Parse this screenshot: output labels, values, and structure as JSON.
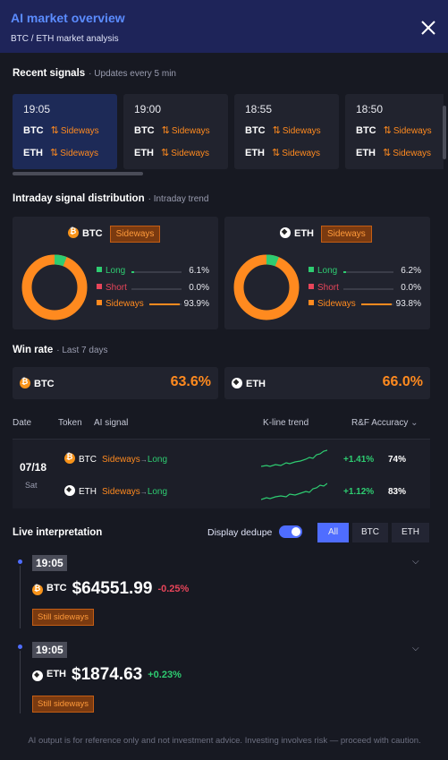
{
  "header": {
    "title": "AI market overview",
    "subtitle": "BTC / ETH market analysis",
    "close_icon": "close-icon"
  },
  "recent_signals": {
    "title": "Recent signals",
    "subtitle": "· Updates every 5 min",
    "cards": [
      {
        "time": "19:05",
        "rows": [
          {
            "token": "BTC",
            "state": "Sideways"
          },
          {
            "token": "ETH",
            "state": "Sideways"
          }
        ]
      },
      {
        "time": "19:00",
        "rows": [
          {
            "token": "BTC",
            "state": "Sideways"
          },
          {
            "token": "ETH",
            "state": "Sideways"
          }
        ]
      },
      {
        "time": "18:55",
        "rows": [
          {
            "token": "BTC",
            "state": "Sideways"
          },
          {
            "token": "ETH",
            "state": "Sideways"
          }
        ]
      },
      {
        "time": "18:50",
        "rows": [
          {
            "token": "BTC",
            "state": "Sideways"
          },
          {
            "token": "ETH",
            "state": "Sideways"
          }
        ]
      }
    ]
  },
  "distribution": {
    "title": "Intraday signal distribution",
    "subtitle": "· Intraday trend",
    "cards": [
      {
        "token": "BTC",
        "tag": "Sideways",
        "items": [
          {
            "label": "Long",
            "value": "6.1%",
            "pct": 6.1,
            "color": "#2ecc71"
          },
          {
            "label": "Short",
            "value": "0.0%",
            "pct": 0.0,
            "color": "#e8455a"
          },
          {
            "label": "Sideways",
            "value": "93.9%",
            "pct": 93.9,
            "color": "#ff8a1f"
          }
        ]
      },
      {
        "token": "ETH",
        "tag": "Sideways",
        "items": [
          {
            "label": "Long",
            "value": "6.2%",
            "pct": 6.2,
            "color": "#2ecc71"
          },
          {
            "label": "Short",
            "value": "0.0%",
            "pct": 0.0,
            "color": "#e8455a"
          },
          {
            "label": "Sideways",
            "value": "93.8%",
            "pct": 93.8,
            "color": "#ff8a1f"
          }
        ]
      }
    ]
  },
  "win_rate": {
    "title": "Win rate",
    "subtitle": "· Last 7 days",
    "cards": [
      {
        "token": "BTC",
        "value": "63.6%"
      },
      {
        "token": "ETH",
        "value": "66.0%"
      }
    ]
  },
  "table": {
    "headers": {
      "date": "Date",
      "token": "Token",
      "signal": "AI signal",
      "trend": "K-line trend",
      "accuracy": "R&F Accuracy"
    },
    "date": "07/18",
    "day": "Sat",
    "rows": [
      {
        "token": "BTC",
        "from": "Sideways",
        "arrow": "→",
        "to": "Long",
        "change": "+1.41%",
        "accuracy": "74%"
      },
      {
        "token": "ETH",
        "from": "Sideways",
        "arrow": "→",
        "to": "Long",
        "change": "+1.12%",
        "accuracy": "83%"
      }
    ]
  },
  "live": {
    "title": "Live interpretation",
    "toggle_label": "Display dedupe",
    "toggle_on": true,
    "filters": [
      "All",
      "BTC",
      "ETH"
    ],
    "active_filter": "All",
    "items": [
      {
        "time": "19:05",
        "token": "BTC",
        "price": "$64551.99",
        "change": "-0.25%",
        "change_color": "#e8455a",
        "status": "Still sideways"
      },
      {
        "time": "19:05",
        "token": "ETH",
        "price": "$1874.63",
        "change": "+0.23%",
        "change_color": "#2ecc71",
        "status": "Still sideways"
      }
    ]
  },
  "footer": {
    "text": "AI output is for reference only and not investment advice. Investing involves risk — proceed with caution."
  }
}
